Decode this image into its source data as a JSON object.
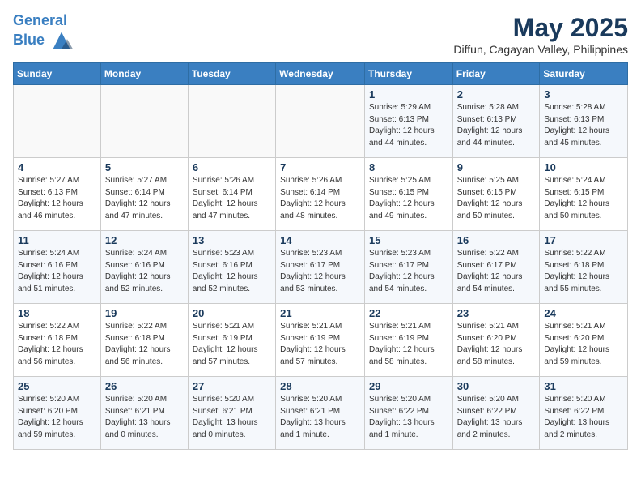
{
  "header": {
    "logo_line1": "General",
    "logo_line2": "Blue",
    "month_year": "May 2025",
    "location": "Diffun, Cagayan Valley, Philippines"
  },
  "days_of_week": [
    "Sunday",
    "Monday",
    "Tuesday",
    "Wednesday",
    "Thursday",
    "Friday",
    "Saturday"
  ],
  "weeks": [
    [
      {
        "num": "",
        "info": ""
      },
      {
        "num": "",
        "info": ""
      },
      {
        "num": "",
        "info": ""
      },
      {
        "num": "",
        "info": ""
      },
      {
        "num": "1",
        "info": "Sunrise: 5:29 AM\nSunset: 6:13 PM\nDaylight: 12 hours\nand 44 minutes."
      },
      {
        "num": "2",
        "info": "Sunrise: 5:28 AM\nSunset: 6:13 PM\nDaylight: 12 hours\nand 44 minutes."
      },
      {
        "num": "3",
        "info": "Sunrise: 5:28 AM\nSunset: 6:13 PM\nDaylight: 12 hours\nand 45 minutes."
      }
    ],
    [
      {
        "num": "4",
        "info": "Sunrise: 5:27 AM\nSunset: 6:13 PM\nDaylight: 12 hours\nand 46 minutes."
      },
      {
        "num": "5",
        "info": "Sunrise: 5:27 AM\nSunset: 6:14 PM\nDaylight: 12 hours\nand 47 minutes."
      },
      {
        "num": "6",
        "info": "Sunrise: 5:26 AM\nSunset: 6:14 PM\nDaylight: 12 hours\nand 47 minutes."
      },
      {
        "num": "7",
        "info": "Sunrise: 5:26 AM\nSunset: 6:14 PM\nDaylight: 12 hours\nand 48 minutes."
      },
      {
        "num": "8",
        "info": "Sunrise: 5:25 AM\nSunset: 6:15 PM\nDaylight: 12 hours\nand 49 minutes."
      },
      {
        "num": "9",
        "info": "Sunrise: 5:25 AM\nSunset: 6:15 PM\nDaylight: 12 hours\nand 50 minutes."
      },
      {
        "num": "10",
        "info": "Sunrise: 5:24 AM\nSunset: 6:15 PM\nDaylight: 12 hours\nand 50 minutes."
      }
    ],
    [
      {
        "num": "11",
        "info": "Sunrise: 5:24 AM\nSunset: 6:16 PM\nDaylight: 12 hours\nand 51 minutes."
      },
      {
        "num": "12",
        "info": "Sunrise: 5:24 AM\nSunset: 6:16 PM\nDaylight: 12 hours\nand 52 minutes."
      },
      {
        "num": "13",
        "info": "Sunrise: 5:23 AM\nSunset: 6:16 PM\nDaylight: 12 hours\nand 52 minutes."
      },
      {
        "num": "14",
        "info": "Sunrise: 5:23 AM\nSunset: 6:17 PM\nDaylight: 12 hours\nand 53 minutes."
      },
      {
        "num": "15",
        "info": "Sunrise: 5:23 AM\nSunset: 6:17 PM\nDaylight: 12 hours\nand 54 minutes."
      },
      {
        "num": "16",
        "info": "Sunrise: 5:22 AM\nSunset: 6:17 PM\nDaylight: 12 hours\nand 54 minutes."
      },
      {
        "num": "17",
        "info": "Sunrise: 5:22 AM\nSunset: 6:18 PM\nDaylight: 12 hours\nand 55 minutes."
      }
    ],
    [
      {
        "num": "18",
        "info": "Sunrise: 5:22 AM\nSunset: 6:18 PM\nDaylight: 12 hours\nand 56 minutes."
      },
      {
        "num": "19",
        "info": "Sunrise: 5:22 AM\nSunset: 6:18 PM\nDaylight: 12 hours\nand 56 minutes."
      },
      {
        "num": "20",
        "info": "Sunrise: 5:21 AM\nSunset: 6:19 PM\nDaylight: 12 hours\nand 57 minutes."
      },
      {
        "num": "21",
        "info": "Sunrise: 5:21 AM\nSunset: 6:19 PM\nDaylight: 12 hours\nand 57 minutes."
      },
      {
        "num": "22",
        "info": "Sunrise: 5:21 AM\nSunset: 6:19 PM\nDaylight: 12 hours\nand 58 minutes."
      },
      {
        "num": "23",
        "info": "Sunrise: 5:21 AM\nSunset: 6:20 PM\nDaylight: 12 hours\nand 58 minutes."
      },
      {
        "num": "24",
        "info": "Sunrise: 5:21 AM\nSunset: 6:20 PM\nDaylight: 12 hours\nand 59 minutes."
      }
    ],
    [
      {
        "num": "25",
        "info": "Sunrise: 5:20 AM\nSunset: 6:20 PM\nDaylight: 12 hours\nand 59 minutes."
      },
      {
        "num": "26",
        "info": "Sunrise: 5:20 AM\nSunset: 6:21 PM\nDaylight: 13 hours\nand 0 minutes."
      },
      {
        "num": "27",
        "info": "Sunrise: 5:20 AM\nSunset: 6:21 PM\nDaylight: 13 hours\nand 0 minutes."
      },
      {
        "num": "28",
        "info": "Sunrise: 5:20 AM\nSunset: 6:21 PM\nDaylight: 13 hours\nand 1 minute."
      },
      {
        "num": "29",
        "info": "Sunrise: 5:20 AM\nSunset: 6:22 PM\nDaylight: 13 hours\nand 1 minute."
      },
      {
        "num": "30",
        "info": "Sunrise: 5:20 AM\nSunset: 6:22 PM\nDaylight: 13 hours\nand 2 minutes."
      },
      {
        "num": "31",
        "info": "Sunrise: 5:20 AM\nSunset: 6:22 PM\nDaylight: 13 hours\nand 2 minutes."
      }
    ]
  ]
}
